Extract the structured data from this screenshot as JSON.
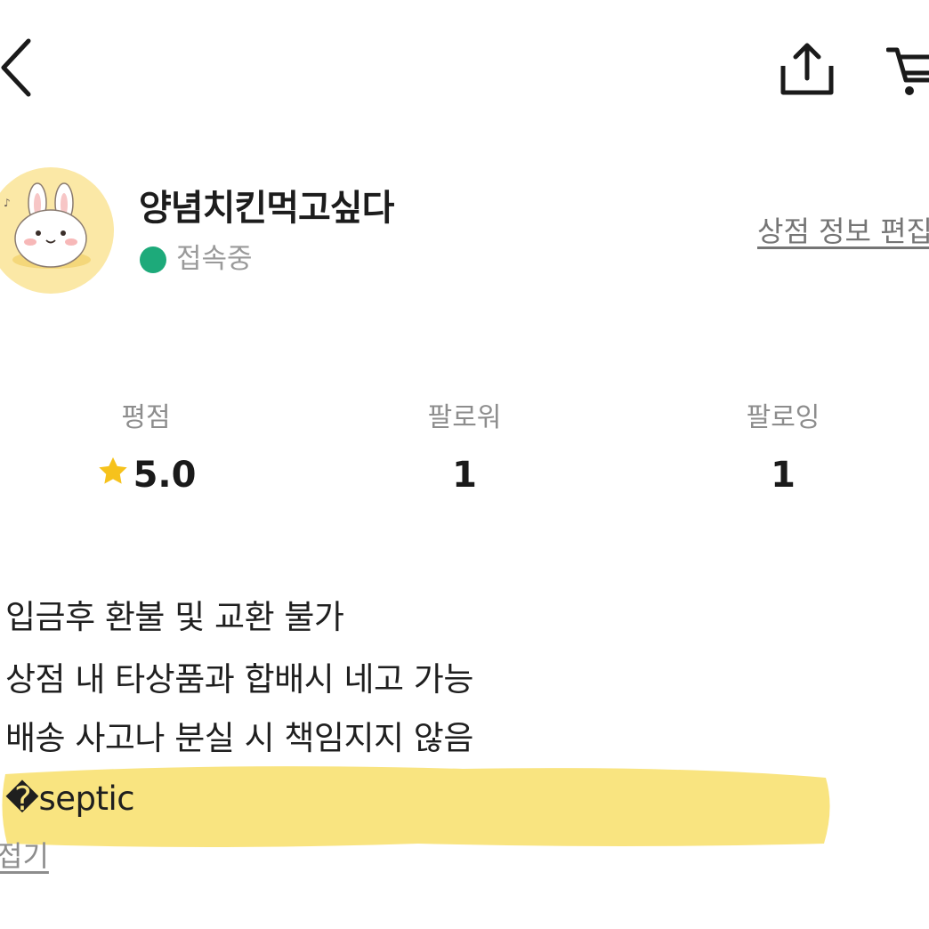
{
  "shop": {
    "name": "양념치킨먹고싶다",
    "status": "접속중",
    "edit_link": "상점 정보 편집"
  },
  "stats": {
    "rating_label": "평점",
    "rating_value": "5.0",
    "followers_label": "팔로워",
    "followers_value": "1",
    "following_label": "팔로잉",
    "following_value": "1"
  },
  "description": {
    "lines": [
      "입금후 환불 및 교환 불가",
      "상점 내 타상품과 합배시 네고 가능",
      "배송 사고나 분실 시 책임지지 않음",
      "�septic"
    ],
    "collapse_label": "접기"
  },
  "icons": {
    "back": "chevron-left-icon",
    "share": "share-icon",
    "cart": "cart-icon",
    "star": "star-icon"
  },
  "colors": {
    "online": "#1daa7a",
    "star": "#f6c21c",
    "highlight": "#f8df6a",
    "avatar_bg": "#fbe8a6"
  }
}
